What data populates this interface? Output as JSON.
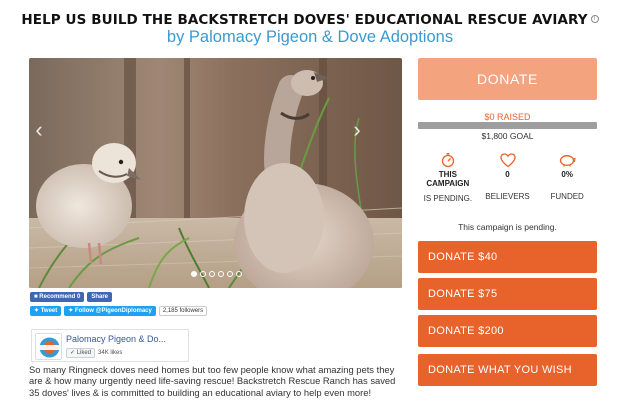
{
  "header": {
    "title": "HELP US BUILD THE BACKSTRETCH DOVES' EDUCATIONAL RESCUE AVIARY",
    "info_glyph": "i",
    "subtitle": "by Palomacy Pigeon & Dove Adoptions"
  },
  "gallery": {
    "prev_glyph": "‹",
    "next_glyph": "›",
    "slide_count": 6,
    "active_slide": 1
  },
  "social": {
    "facebook_recommend": "Recommend 0",
    "facebook_share": "Share",
    "tweet": "Tweet",
    "follow": "Follow @PigeonDiplomacy",
    "followers": "2,185 followers"
  },
  "facebook_card": {
    "page_name": "Palomacy Pigeon & Do...",
    "liked_label": "Liked",
    "likes": "34K likes"
  },
  "description": "So many Ringneck doves need homes but too few people know what amazing pets they are & how many urgently need life-saving rescue! Backstretch Rescue Ranch has saved 35 doves' lives & is committed to building an educational aviary to help even more!",
  "campaign": {
    "donate_label": "DONATE",
    "raised": "$0 RAISED",
    "progress_percent": 0,
    "goal": "$1,800 GOAL",
    "stats": [
      {
        "icon": "stopwatch-icon",
        "value": "THIS CAMPAIGN",
        "label": "IS PENDING."
      },
      {
        "icon": "heart-icon",
        "value": "0",
        "label": "BELIEVERS"
      },
      {
        "icon": "piggy-bank-icon",
        "value": "0%",
        "label": "FUNDED"
      }
    ],
    "status_text": "This campaign is pending.",
    "donate_options": [
      "DONATE $40",
      "DONATE $75",
      "DONATE $200",
      "DONATE WHAT YOU WISH"
    ]
  },
  "colors": {
    "accent": "#e8632b",
    "accent_light": "#f3a47f",
    "link_blue": "#3a9ad0",
    "progress_track": "#9e9e9e"
  }
}
